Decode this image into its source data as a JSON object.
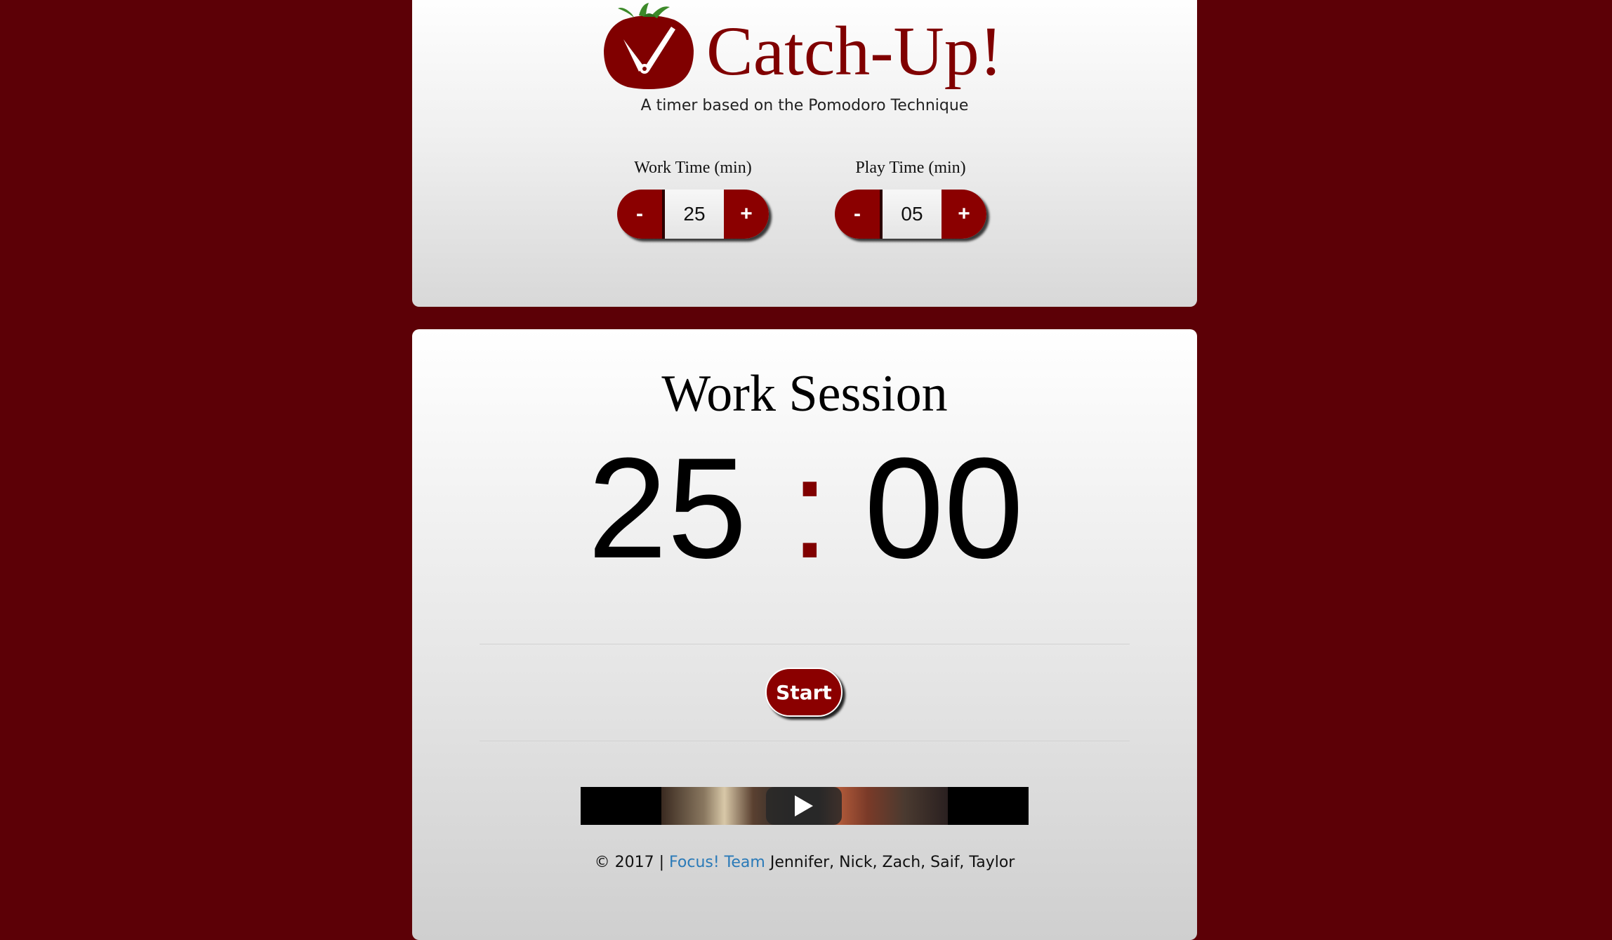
{
  "header": {
    "app_title": "Catch-Up!",
    "subtitle": "A timer based on the Pomodoro Technique",
    "logo_icon": "tomato-clock-icon"
  },
  "settings": {
    "work": {
      "label": "Work Time (min)",
      "decrement_label": "-",
      "value": "25",
      "increment_label": "+"
    },
    "play": {
      "label": "Play Time (min)",
      "decrement_label": "-",
      "value": "05",
      "increment_label": "+"
    }
  },
  "timer": {
    "session_title": "Work Session",
    "minutes": "25",
    "separator": ":",
    "seconds": "00",
    "start_label": "Start"
  },
  "video": {
    "play_icon": "play-icon"
  },
  "footer": {
    "copyright": "© 2017 |",
    "team_link": "Focus! Team",
    "members": "Jennifer, Nick, Zach, Saif, Taylor"
  },
  "colors": {
    "background": "#5c0006",
    "accent": "#8b0000",
    "title": "#800000",
    "link": "#2a7ab8"
  }
}
